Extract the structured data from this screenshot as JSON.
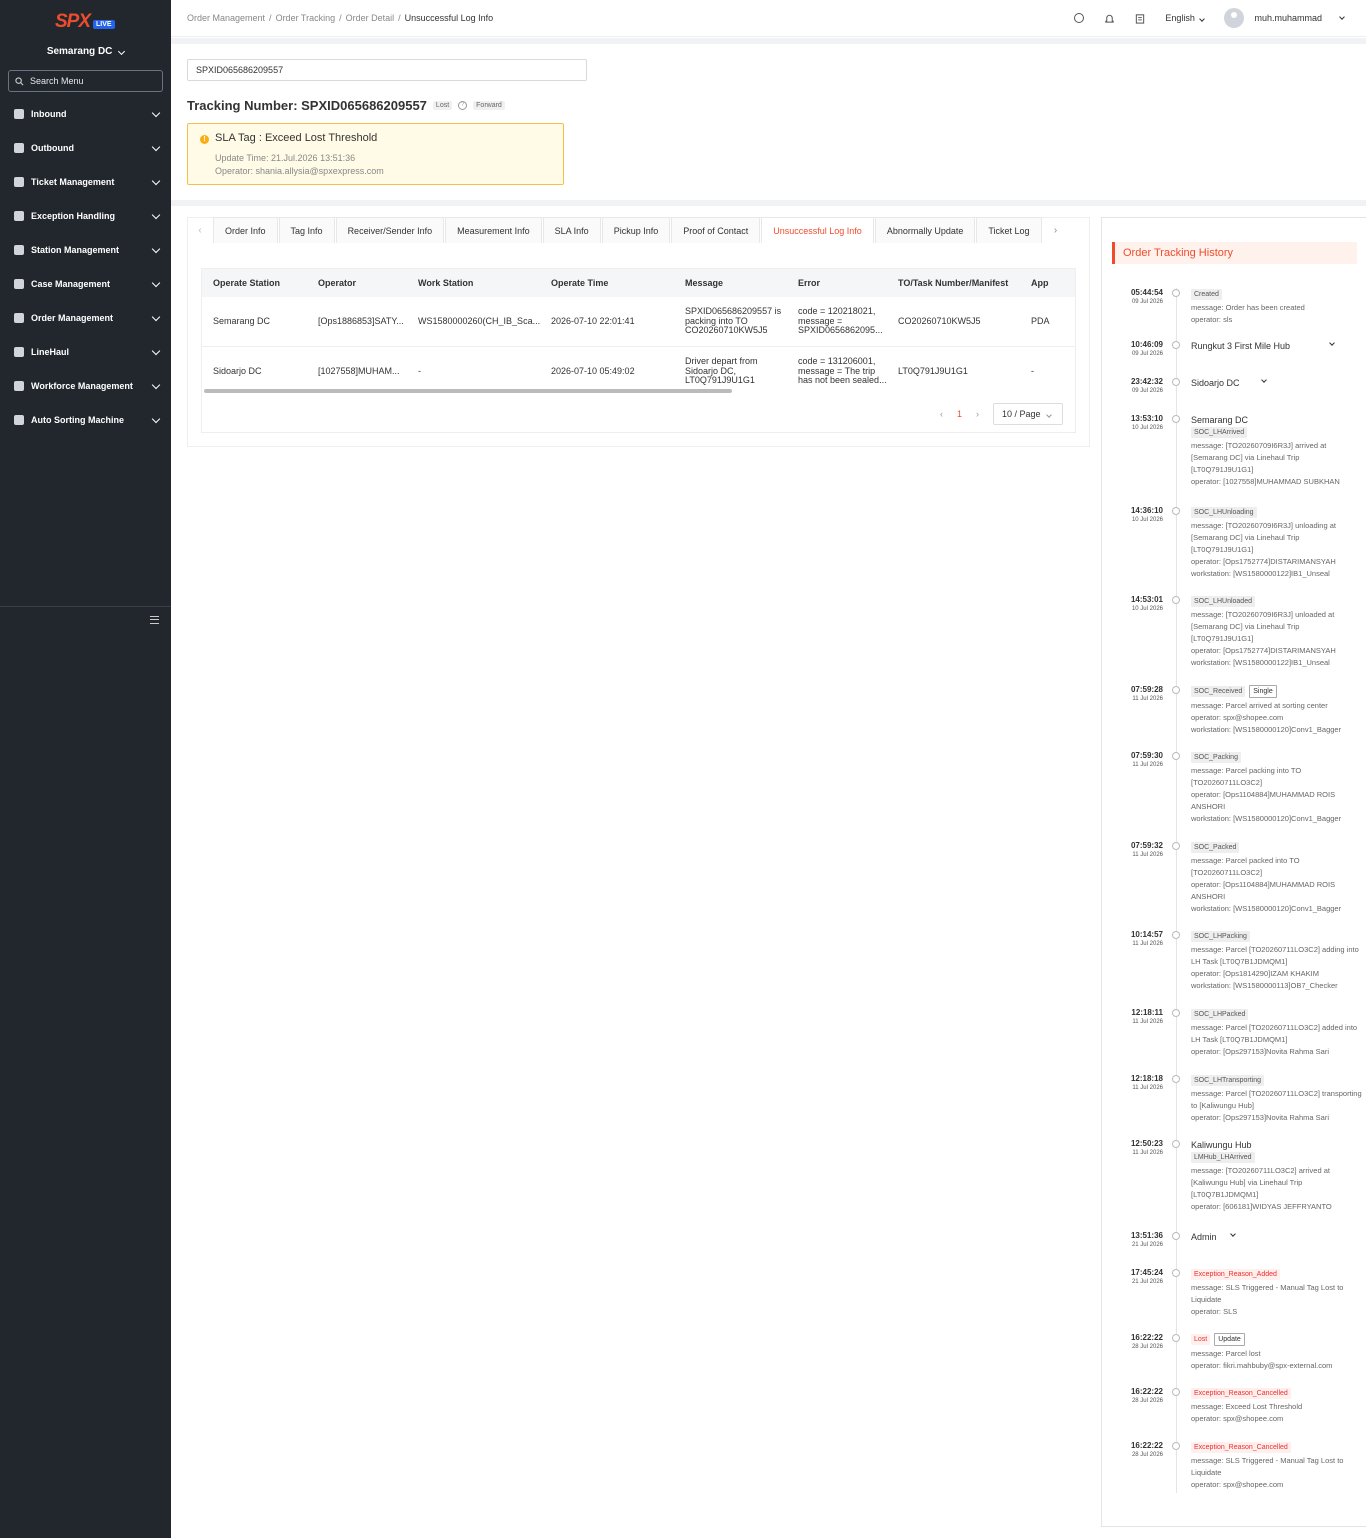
{
  "app": {
    "logo": "SPX",
    "live": "LIVE",
    "station": "Semarang DC",
    "search_placeholder": "Search Menu"
  },
  "menu": [
    "Inbound",
    "Outbound",
    "Ticket Management",
    "Exception Handling",
    "Station Management",
    "Case Management",
    "Order Management",
    "LineHaul",
    "Workforce Management",
    "Auto Sorting Machine"
  ],
  "breadcrumb": [
    "Order Management",
    "Order Tracking",
    "Order Detail",
    "Unsuccessful Log Info"
  ],
  "top": {
    "language": "English",
    "user": "muh.muhammad"
  },
  "tracking": {
    "input_value": "SPXID065686209557",
    "title": "Tracking Number: SPXID065686209557",
    "tag_lost": "Lost",
    "tag_forward": "Forward"
  },
  "sla": {
    "title": "SLA Tag : Exceed Lost Threshold",
    "update_time": "Update Time: 21.Jul.2026 13:51:36",
    "operator": "Operator: shania.allysia@spxexpress.com"
  },
  "tabs": [
    "Order Info",
    "Tag Info",
    "Receiver/Sender Info",
    "Measurement Info",
    "SLA Info",
    "Pickup Info",
    "Proof of Contact",
    "Unsuccessful Log Info",
    "Abnormally Update",
    "Ticket Log"
  ],
  "table": {
    "headers": [
      "Operate Station",
      "Operator",
      "Work Station",
      "Operate Time",
      "Message",
      "Error",
      "TO/Task Number/Manifest",
      "App"
    ],
    "rows": [
      [
        "Semarang DC",
        "[Ops1886853]SATY...",
        "WS1580000260(CH_IB_Sca...",
        "2026-07-10 22:01:41",
        "SPXID065686209557 is packing into TO CO20260710KW5J5",
        "code = 120218021, message = SPXID0656862095...",
        "CO20260710KW5J5",
        "PDA"
      ],
      [
        "Sidoarjo DC",
        "[1027558]MUHAM...",
        "-",
        "2026-07-10 05:49:02",
        "Driver depart from Sidoarjo DC, LT0Q791J9U1G1",
        "code = 131206001, message = The trip has not been sealed...",
        "LT0Q791J9U1G1",
        "-"
      ]
    ],
    "page": "1",
    "page_size": "10 / Page"
  },
  "history": {
    "title": "Order Tracking History",
    "events": [
      {
        "time": "05:44:54",
        "date": "09 Jul 2026",
        "badge": "Created",
        "lines": [
          "message: Order has been created",
          "operator: sls"
        ]
      },
      {
        "time": "10:46:09",
        "date": "09 Jul 2026",
        "loc": "Rungkut 3 First Mile Hub"
      },
      {
        "time": "23:42:32",
        "date": "09 Jul 2026",
        "loc": "Sidoarjo DC"
      },
      {
        "time": "13:53:10",
        "date": "10 Jul 2026",
        "loc": "Semarang DC",
        "badge": "SOC_LHArrived",
        "lines": [
          "message: [TO20260709I6R3J] arrived at [Semarang DC] via Linehaul Trip [LT0Q791J9U1G1]",
          "operator: [1027558]MUHAMMAD SUBKHAN"
        ]
      },
      {
        "time": "14:36:10",
        "date": "10 Jul 2026",
        "badge": "SOC_LHUnloading",
        "lines": [
          "message: [TO20260709I6R3J] unloading at [Semarang DC] via Linehaul Trip [LT0Q791J9U1G1]",
          "operator: [Ops1752774]DISTARIMANSYAH",
          "workstation: [WS1580000122]IB1_Unseal"
        ]
      },
      {
        "time": "14:53:01",
        "date": "10 Jul 2026",
        "badge": "SOC_LHUnloaded",
        "lines": [
          "message: [TO20260709I6R3J] unloaded at [Semarang DC] via Linehaul Trip [LT0Q791J9U1G1]",
          "operator: [Ops1752774]DISTARIMANSYAH",
          "workstation: [WS1580000122]IB1_Unseal"
        ]
      },
      {
        "time": "07:59:28",
        "date": "11 Jul 2026",
        "badge": "SOC_Received",
        "badge2": "Single",
        "lines": [
          "message: Parcel arrived at sorting center",
          "operator: spx@shopee.com",
          "workstation: [WS1580000120]Conv1_Bagger"
        ]
      },
      {
        "time": "07:59:30",
        "date": "11 Jul 2026",
        "badge": "SOC_Packing",
        "lines": [
          "message: Parcel packing into TO [TO20260711LO3C2]",
          "operator: [Ops1104884]MUHAMMAD ROIS ANSHORI",
          "workstation: [WS1580000120]Conv1_Bagger"
        ]
      },
      {
        "time": "07:59:32",
        "date": "11 Jul 2026",
        "badge": "SOC_Packed",
        "lines": [
          "message: Parcel packed into TO [TO20260711LO3C2]",
          "operator: [Ops1104884]MUHAMMAD ROIS ANSHORI",
          "workstation: [WS1580000120]Conv1_Bagger"
        ]
      },
      {
        "time": "10:14:57",
        "date": "11 Jul 2026",
        "badge": "SOC_LHPacking",
        "lines": [
          "message: Parcel [TO20260711LO3C2] adding into LH Task [LT0Q7B1JDMQM1]",
          "operator: [Ops1814290]IZAM KHAKIM",
          "workstation: [WS1580000113]OB7_Checker"
        ]
      },
      {
        "time": "12:18:11",
        "date": "11 Jul 2026",
        "badge": "SOC_LHPacked",
        "lines": [
          "message: Parcel [TO20260711LO3C2] added into LH Task [LT0Q7B1JDMQM1]",
          "operator: [Ops297153]Novita Rahma Sari"
        ]
      },
      {
        "time": "12:18:18",
        "date": "11 Jul 2026",
        "badge": "SOC_LHTransporting",
        "lines": [
          "message: Parcel [TO20260711LO3C2] transporting to [Kaliwungu Hub]",
          "operator: [Ops297153]Novita Rahma Sari"
        ]
      },
      {
        "time": "12:50:23",
        "date": "11 Jul 2026",
        "loc": "Kaliwungu Hub",
        "badge": "LMHub_LHArrived",
        "lines": [
          "message: [TO20260711LO3C2] arrived at [Kaliwungu Hub] via Linehaul Trip [LT0Q7B1JDMQM1]",
          "operator: [606181]WIDYAS JEFFRYANTO"
        ]
      },
      {
        "time": "13:51:36",
        "date": "21 Jul 2026",
        "loc": "Admin"
      },
      {
        "time": "17:45:24",
        "date": "21 Jul 2026",
        "badge": "Exception_Reason_Added",
        "red": true,
        "lines": [
          "message: SLS Triggered - Manual Tag Lost to Liquidate",
          "operator: SLS"
        ]
      },
      {
        "time": "16:22:22",
        "date": "28 Jul 2026",
        "badge": "Lost",
        "red": true,
        "badge2": "Update",
        "lines": [
          "message: Parcel lost",
          "operator: fikri.mahbuby@spx-external.com"
        ]
      },
      {
        "time": "16:22:22",
        "date": "28 Jul 2026",
        "badge": "Exception_Reason_Cancelled",
        "red": true,
        "lines": [
          "message: Exceed Lost Threshold",
          "operator: spx@shopee.com"
        ]
      },
      {
        "time": "16:22:22",
        "date": "28 Jul 2026",
        "badge": "Exception_Reason_Cancelled",
        "red": true,
        "lines": [
          "message: SLS Triggered - Manual Tag Lost to Liquidate",
          "operator: spx@shopee.com"
        ]
      }
    ]
  }
}
